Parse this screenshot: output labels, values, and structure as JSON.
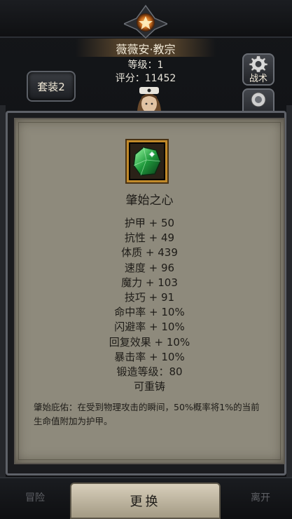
{
  "character": {
    "name": "薇薇安·教宗",
    "level": "等级：1",
    "score": "评分：11452"
  },
  "buttons": {
    "set": "套装2",
    "tactics": "战术",
    "second_side": "",
    "swap": "更换",
    "adventure": "冒险",
    "leave": "离开"
  },
  "item": {
    "name": "肇始之心",
    "icon": "green-gem-icon",
    "stats": [
      "护甲 + 50",
      "抗性 + 49",
      "体质 + 439",
      "速度 + 96",
      "魔力 + 103",
      "技巧 + 91",
      "命中率 + 10%",
      "闪避率 + 10%",
      "回复效果 + 10%",
      "暴击率 + 10%",
      "锻造等级：80",
      "可重铸"
    ],
    "description": "肇始庇佑：在受到物理攻击的瞬间，50%概率将1%的当前生命值附加为护甲。"
  },
  "colors": {
    "panel": "#8e8a7c",
    "gold_frame": "#c18a2a",
    "text_dark": "#1e1c18",
    "text_light": "#f2ead8"
  }
}
